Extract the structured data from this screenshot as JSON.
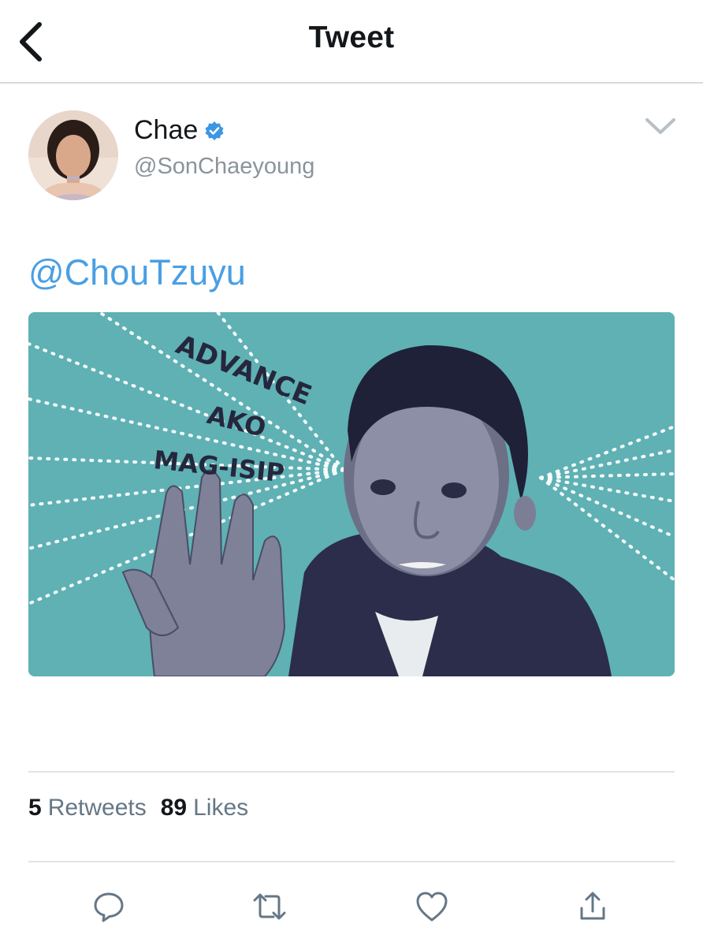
{
  "nav": {
    "title": "Tweet"
  },
  "author": {
    "display_name": "Chae",
    "handle": "@SonChaeyoung",
    "verified": true
  },
  "tweet": {
    "mention": "@ChouTzuyu",
    "media": {
      "caption_lines": [
        "ADVANCE",
        "AKO",
        "MAG-ISIP"
      ],
      "background_color": "#5fb1b4"
    }
  },
  "stats": {
    "retweets_count": "5",
    "retweets_label": "Retweets",
    "likes_count": "89",
    "likes_label": "Likes"
  },
  "actions": [
    "reply-icon",
    "retweet-icon",
    "like-icon",
    "share-icon"
  ],
  "colors": {
    "link": "#4a9fe3",
    "verified": "#3c96e4",
    "icon_gray": "#657786"
  }
}
